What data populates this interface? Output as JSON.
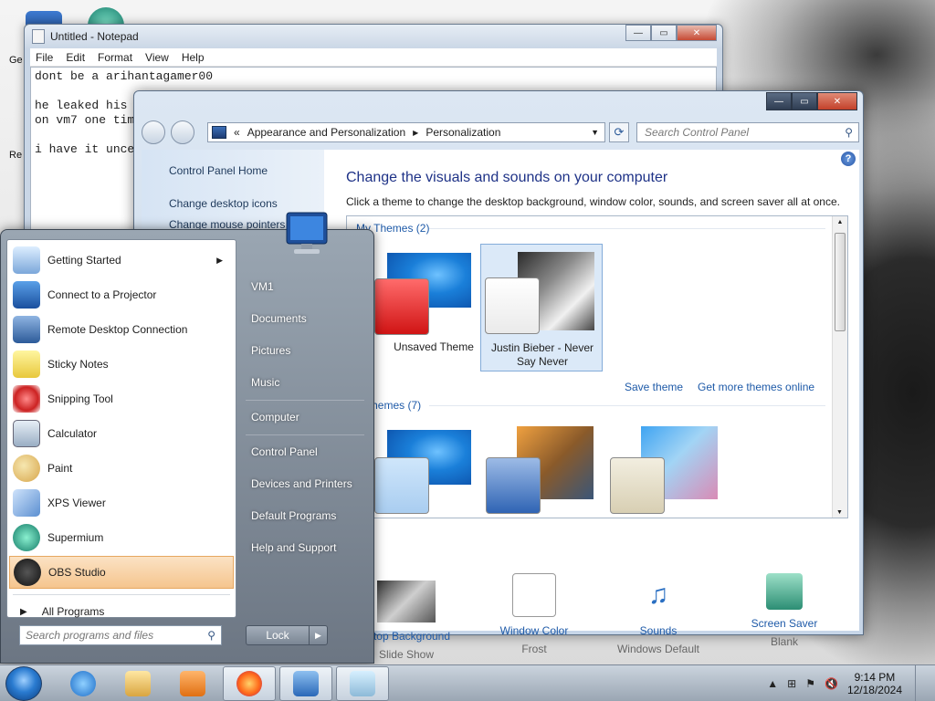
{
  "desktop": {
    "icons": [
      {
        "label": "Ge"
      },
      {
        "label": "Re"
      }
    ]
  },
  "notepad": {
    "title": "Untitled - Notepad",
    "menu": [
      "File",
      "Edit",
      "Format",
      "View",
      "Help"
    ],
    "lines": [
      "dont be a arihantagamer00",
      "",
      "he leaked his",
      "on vm7 one tim",
      "",
      "i have it unce"
    ]
  },
  "control_panel": {
    "breadcrumb_lead": "«",
    "breadcrumb": [
      "Appearance and Personalization",
      "Personalization"
    ],
    "search_placeholder": "Search Control Panel",
    "sidebar_links": [
      "Control Panel Home",
      "Change desktop icons",
      "Change mouse pointers"
    ],
    "heading": "Change the visuals and sounds on your computer",
    "subheading": "Click a theme to change the desktop background, window color, sounds, and screen saver all at once.",
    "my_themes_title": "My Themes (2)",
    "aero_themes_title": "o Themes (7)",
    "my_themes": [
      {
        "label": "Unsaved Theme"
      },
      {
        "label": "Justin Bieber - Never Say Never"
      }
    ],
    "save_theme": "Save theme",
    "get_more_themes": "Get more themes online",
    "settings": [
      {
        "name": "sktop Background",
        "value": "Slide Show"
      },
      {
        "name": "Window Color",
        "value": "Frost"
      },
      {
        "name": "Sounds",
        "value": "Windows Default"
      },
      {
        "name": "Screen Saver",
        "value": "Blank"
      }
    ]
  },
  "start_menu": {
    "programs": [
      {
        "label": "Getting Started",
        "icon": "getting-started-icon",
        "has_arrow": true
      },
      {
        "label": "Connect to a Projector",
        "icon": "projector-icon"
      },
      {
        "label": "Remote Desktop Connection",
        "icon": "remote-desktop-icon"
      },
      {
        "label": "Sticky Notes",
        "icon": "sticky-notes-icon"
      },
      {
        "label": "Snipping Tool",
        "icon": "snipping-tool-icon"
      },
      {
        "label": "Calculator",
        "icon": "calculator-icon"
      },
      {
        "label": "Paint",
        "icon": "paint-icon"
      },
      {
        "label": "XPS Viewer",
        "icon": "xps-viewer-icon"
      },
      {
        "label": "Supermium",
        "icon": "supermium-icon"
      },
      {
        "label": "OBS Studio",
        "icon": "obs-icon",
        "highlighted": true
      }
    ],
    "all_programs": "All Programs",
    "search_placeholder": "Search programs and files",
    "right_items": [
      "VM1",
      "Documents",
      "Pictures",
      "Music",
      "Computer",
      "Control Panel",
      "Devices and Printers",
      "Default Programs",
      "Help and Support"
    ],
    "lock_label": "Lock"
  },
  "taskbar": {
    "clock_time": "9:14 PM",
    "clock_date": "12/18/2024",
    "pinned": [
      "internet-explorer-icon",
      "explorer-icon",
      "media-player-icon",
      "firefox-icon",
      "control-panel-icon",
      "notepad-icon"
    ]
  },
  "colors": {
    "link_blue": "#1e5aa8",
    "heading_blue": "#1e3287",
    "highlight_orange": "#f5c58e"
  }
}
